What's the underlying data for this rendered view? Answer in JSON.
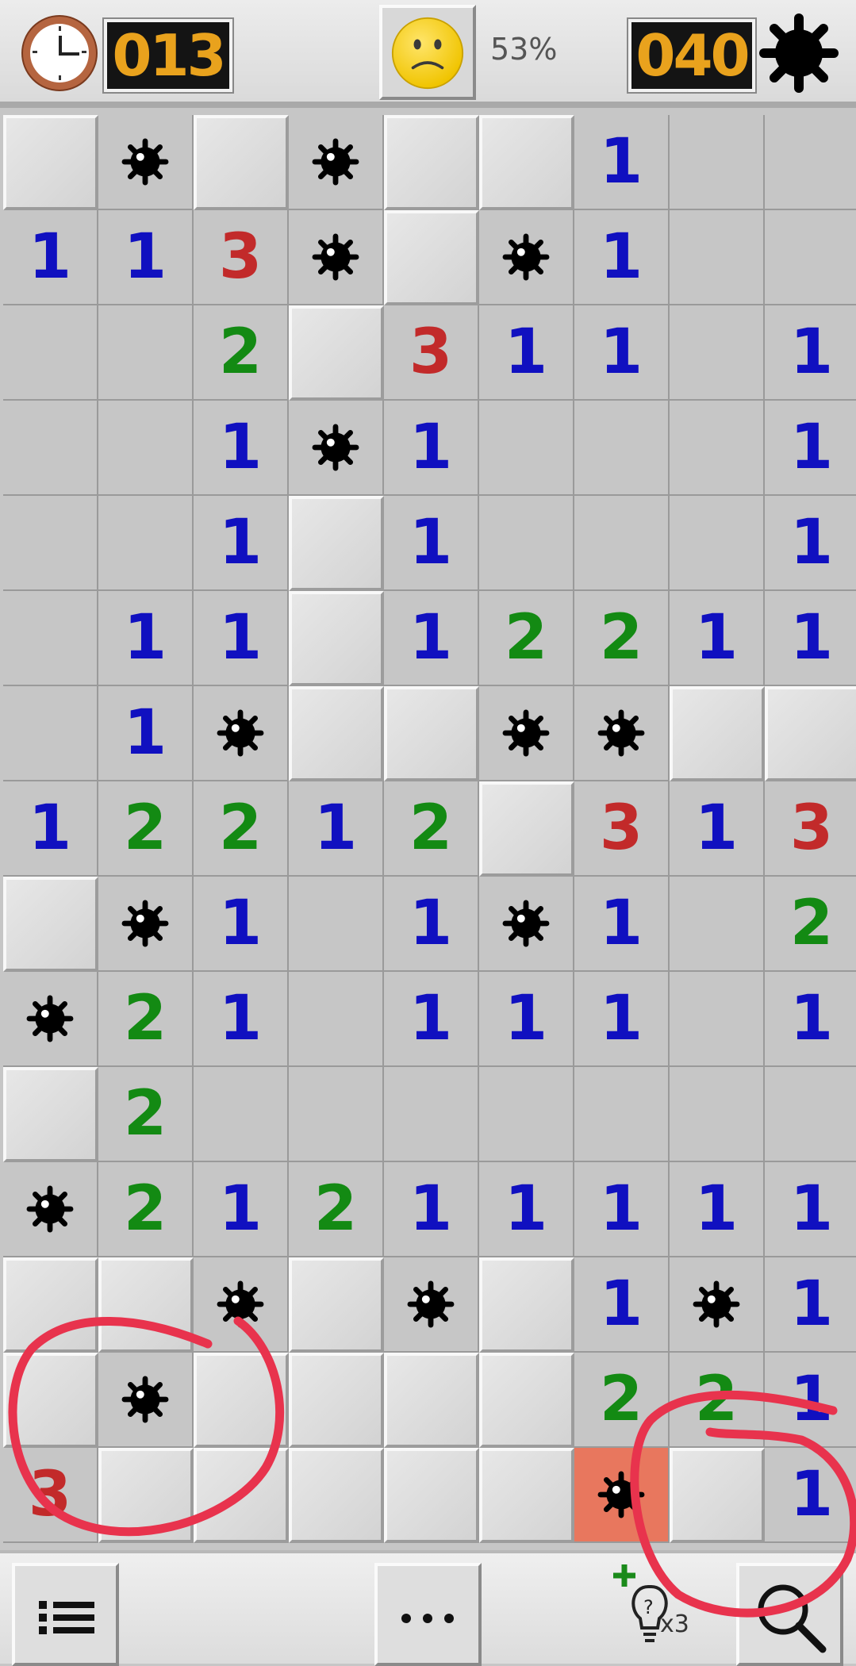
{
  "header": {
    "timer": "013",
    "mines_remaining": "040",
    "progress_percent": "53%",
    "face_state": "worried-face-icon"
  },
  "board": {
    "cols": 9,
    "rows": 15,
    "legend": "H = unrevealed, M = mine, X = exploded mine, E = empty revealed, digits = neighbor count",
    "grid": [
      [
        "H",
        "M",
        "H",
        "M",
        "H",
        "H",
        "1",
        "E",
        "E"
      ],
      [
        "1",
        "1",
        "3",
        "M",
        "H",
        "M",
        "1",
        "E",
        "E"
      ],
      [
        "E",
        "E",
        "2",
        "H",
        "3",
        "1",
        "1",
        "E",
        "1"
      ],
      [
        "E",
        "E",
        "1",
        "M",
        "1",
        "E",
        "E",
        "E",
        "1"
      ],
      [
        "E",
        "E",
        "1",
        "H",
        "1",
        "E",
        "E",
        "E",
        "1"
      ],
      [
        "E",
        "1",
        "1",
        "H",
        "1",
        "2",
        "2",
        "1",
        "1"
      ],
      [
        "E",
        "1",
        "M",
        "H",
        "H",
        "M",
        "M",
        "H",
        "H"
      ],
      [
        "1",
        "2",
        "2",
        "1",
        "2",
        "H",
        "3",
        "1",
        "3"
      ],
      [
        "H",
        "M",
        "1",
        "E",
        "1",
        "M",
        "1",
        "E",
        "2"
      ],
      [
        "M",
        "2",
        "1",
        "E",
        "1",
        "1",
        "1",
        "E",
        "1"
      ],
      [
        "H",
        "2",
        "E",
        "E",
        "E",
        "E",
        "E",
        "E",
        "E"
      ],
      [
        "M",
        "2",
        "1",
        "2",
        "1",
        "1",
        "1",
        "1",
        "1"
      ],
      [
        "H",
        "H",
        "M",
        "H",
        "M",
        "H",
        "1",
        "M",
        "1"
      ],
      [
        "H",
        "M",
        "H",
        "H",
        "H",
        "H",
        "2",
        "2",
        "1"
      ],
      [
        "3",
        "H",
        "H",
        "H",
        "H",
        "H",
        "X",
        "H",
        "1"
      ]
    ]
  },
  "toolbar": {
    "menu_icon": "list-icon",
    "more_icon": "more-dots-icon",
    "hint_icon": "hint-bulb-icon",
    "hint_count": "x3",
    "search_icon": "magnifier-icon"
  },
  "colors": {
    "n1": "#1010c0",
    "n2": "#138a13",
    "n3": "#c22a2a",
    "exploded": "#e8775e",
    "counter_digits": "#e9a21d",
    "annotation_stroke": "#e8334d"
  }
}
